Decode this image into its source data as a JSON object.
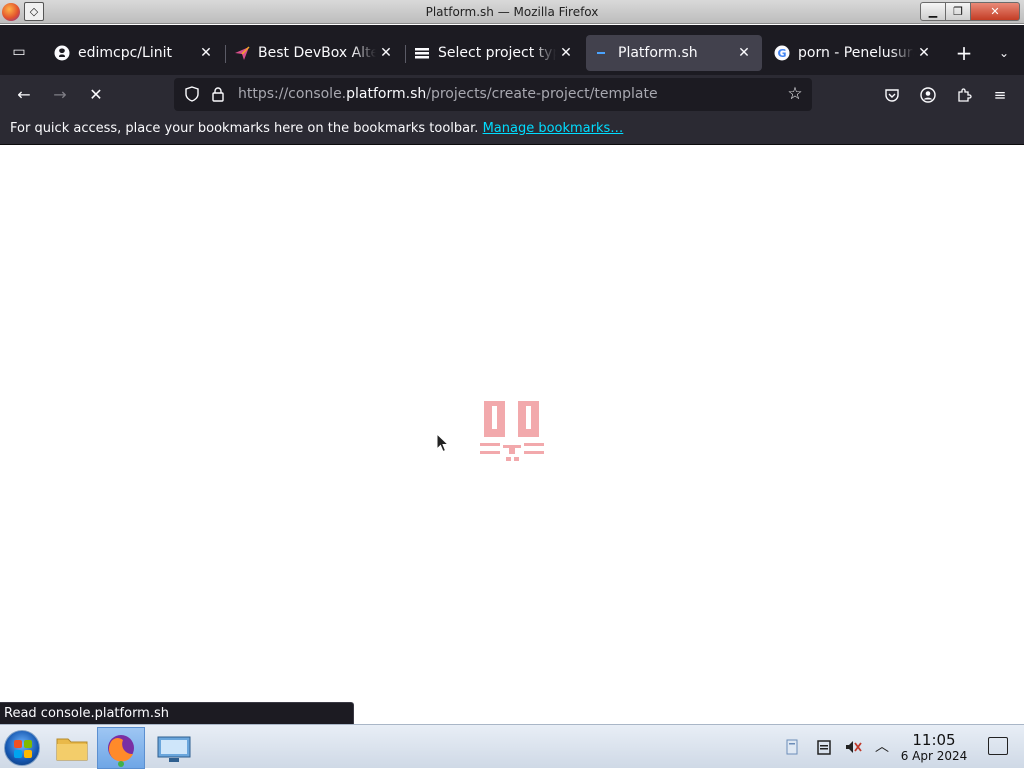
{
  "window": {
    "title": "Platform.sh — Mozilla Firefox",
    "minimize": "▁",
    "maximize": "❐",
    "close": "✕"
  },
  "tabs": [
    {
      "label": "edimcpc/Linit",
      "icon": "github-icon",
      "active": false
    },
    {
      "label": "Best DevBox Alter",
      "icon": "paper-plane-icon",
      "active": false
    },
    {
      "label": "Select project type",
      "icon": "list-icon",
      "active": false
    },
    {
      "label": "Platform.sh",
      "icon": "platform-sh-icon",
      "active": true
    },
    {
      "label": "porn - Penelusuran",
      "icon": "google-icon",
      "active": false
    }
  ],
  "tab_close_glyph": "✕",
  "new_tab_glyph": "+",
  "navbar": {
    "url_prefix": "https://console.",
    "url_host": "platform.sh",
    "url_path": "/projects/create-project/template",
    "back_glyph": "←",
    "forward_glyph": "→",
    "stop_glyph": "✕"
  },
  "bookmarks_bar": {
    "message": "For quick access, place your bookmarks here on the bookmarks toolbar. ",
    "link": "Manage bookmarks…"
  },
  "status_text": "Read console.platform.sh",
  "taskbar": {
    "time": "11:05",
    "date": "6 Apr 2024"
  },
  "colors": {
    "loader_accent": "#e8646a",
    "link": "#00ddff",
    "tab_strip": "#1c1b22",
    "toolbar": "#2b2a33"
  }
}
